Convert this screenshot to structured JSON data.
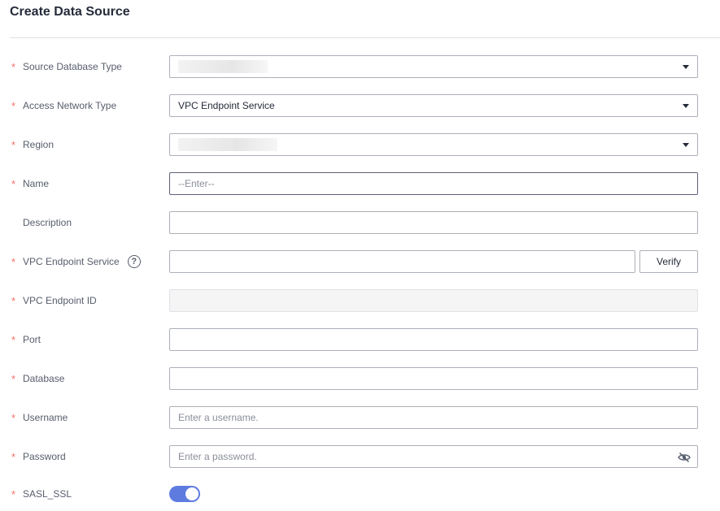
{
  "page": {
    "title": "Create Data Source"
  },
  "form": {
    "source_database_type": {
      "label": "Source Database Type",
      "value": ""
    },
    "access_network_type": {
      "label": "Access Network Type",
      "value": "VPC Endpoint Service"
    },
    "region": {
      "label": "Region",
      "value": ""
    },
    "name": {
      "label": "Name",
      "placeholder": "--Enter--"
    },
    "description": {
      "label": "Description",
      "value": ""
    },
    "vpc_endpoint_service": {
      "label": "VPC Endpoint Service",
      "help_glyph": "?",
      "value": "",
      "verify_label": "Verify"
    },
    "vpc_endpoint_id": {
      "label": "VPC Endpoint ID",
      "value": ""
    },
    "port": {
      "label": "Port",
      "value": ""
    },
    "database": {
      "label": "Database",
      "value": ""
    },
    "username": {
      "label": "Username",
      "placeholder": "Enter a username."
    },
    "password": {
      "label": "Password",
      "placeholder": "Enter a password."
    },
    "sasl_ssl": {
      "label": "SASL_SSL",
      "enabled": true
    }
  },
  "colors": {
    "accent": "#5e7ce0",
    "required": "#f66f6a",
    "border": "#adb0b8"
  },
  "icons": {
    "help": "question-circle-icon",
    "password_toggle": "eye-hidden-icon",
    "dropdown": "caret-down-icon"
  }
}
